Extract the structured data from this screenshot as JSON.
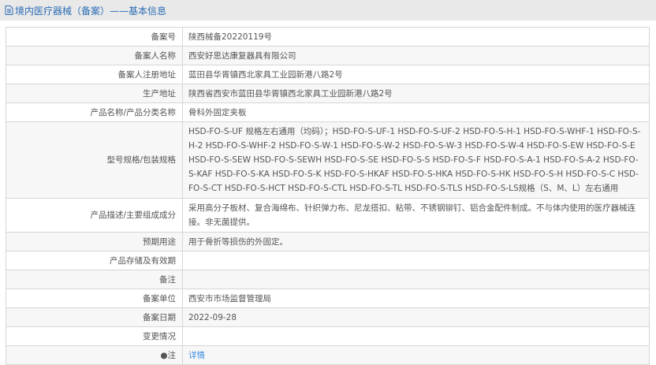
{
  "header": {
    "title": "境内医疗器械（备案）——基本信息",
    "icon": "document-icon"
  },
  "rows": [
    {
      "label": "备案号",
      "value": "陕西械备20220119号"
    },
    {
      "label": "备案人名称",
      "value": "西安好思达康复器具有限公司"
    },
    {
      "label": "备案人注册地址",
      "value": "蓝田县华胥镇西北家具工业园新港八路2号"
    },
    {
      "label": "生产地址",
      "value": "陕西省西安市蓝田县华胥镇西北家具工业园新港八路2号"
    },
    {
      "label": "产品名称/产品分类名称",
      "value": "骨科外固定夹板"
    },
    {
      "label": "型号规格/包装规格",
      "value": "HSD-FO-S-UF 规格左右通用（均码）；HSD-FO-S-UF-1 HSD-FO-S-UF-2 HSD-FO-S-H-1 HSD-FO-S-WHF-1 HSD-FO-S-H-2 HSD-FO-S-WHF-2 HSD-FO-S-W-1 HSD-FO-S-W-2 HSD-FO-S-W-3 HSD-FO-S-W-4 HSD-FO-S-EW HSD-FO-S-E HSD-FO-S-SEW HSD-FO-S-SEWH HSD-FO-S-SE HSD-FO-S-S HSD-FO-S-F HSD-FO-S-A-1 HSD-FO-S-A-2 HSD-FO-S-KAF HSD-FO-S-KA HSD-FO-S-K HSD-FO-S-HKAF HSD-FO-S-HKA HSD-FO-S-HK HSD-FO-S-H HSD-FO-S-C HSD-FO-S-CT HSD-FO-S-HCT HSD-FO-S-CTL HSD-FO-S-TL HSD-FO-S-TLS HSD-FO-S-LS规格（S、M、L）左右通用"
    },
    {
      "label": "产品描述/主要组成成分",
      "value": "采用高分子板材、复合海绵布、针织弹力布、尼龙搭扣、粘带、不锈钢铆钉、铝合金配件制成。不与体内使用的医疗器械连接。非无菌提供。"
    },
    {
      "label": "预期用途",
      "value": "用于骨折等损伤的外固定。"
    },
    {
      "label": "产品存储及有效期",
      "value": ""
    },
    {
      "label": "备注",
      "value": ""
    },
    {
      "label": "备案单位",
      "value": "西安市市场监督管理局"
    },
    {
      "label": "备案日期",
      "value": "2022-09-28"
    },
    {
      "label": "变更情况",
      "value": ""
    }
  ],
  "note": {
    "label": "注",
    "icon": "info-bulb-icon",
    "link": "详情"
  }
}
